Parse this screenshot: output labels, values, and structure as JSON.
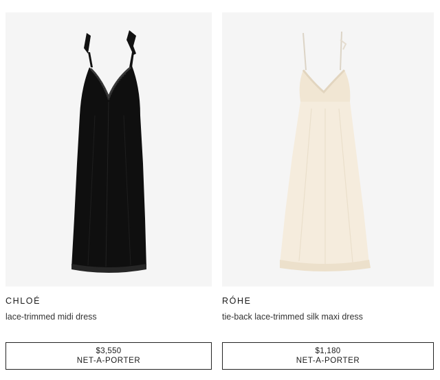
{
  "products": [
    {
      "brand": "CHLOÉ",
      "name": "lace-trimmed midi dress",
      "price": "$3,550",
      "retailer": "NET-A-PORTER",
      "image_icon": "black-slip-dress",
      "dress_color": "#111111"
    },
    {
      "brand": "RÓHE",
      "name": "tie-back lace-trimmed silk maxi dress",
      "price": "$1,180",
      "retailer": "NET-A-PORTER",
      "image_icon": "ivory-slip-dress",
      "dress_color": "#f4ead9"
    }
  ]
}
